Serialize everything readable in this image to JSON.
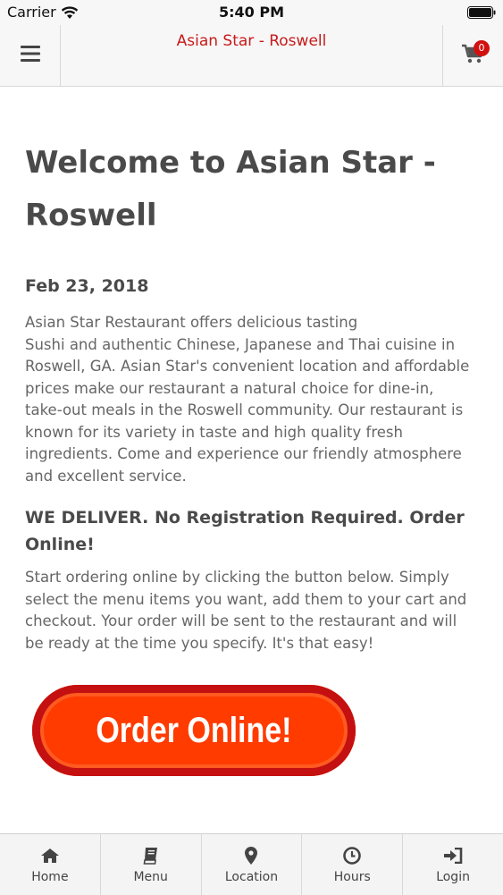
{
  "status_bar": {
    "carrier": "Carrier",
    "time": "5:40 PM"
  },
  "header": {
    "title": "Asian Star - Roswell",
    "cart_count": "0"
  },
  "main": {
    "title": "Welcome to Asian Star - Roswell",
    "date": "Feb 23, 2018",
    "intro_lines": [
      "Asian Star Restaurant offers delicious tasting",
      "Sushi and authentic Chinese, Japanese and Thai cuisine in Roswell, GA. Asian Star's convenient location and affordable prices make our restaurant a natural choice for dine-in, take-out meals in the Roswell community. Our restaurant is known for its variety in taste and high quality fresh ingredients. Come and experience our friendly atmosphere and excellent service."
    ],
    "delivery_heading": "WE DELIVER. No Registration Required. Order Online!",
    "instructions": "Start ordering online by clicking the button below. Simply select the menu items you want, add them to your cart and checkout. Your order will be sent to the restaurant and will be ready at the time you specify. It's that easy!",
    "order_button_label": "Order Online!"
  },
  "tabs": [
    {
      "label": "Home",
      "icon": "home-icon"
    },
    {
      "label": "Menu",
      "icon": "book-icon"
    },
    {
      "label": "Location",
      "icon": "map-marker-icon"
    },
    {
      "label": "Hours",
      "icon": "clock-icon"
    },
    {
      "label": "Login",
      "icon": "sign-in-icon"
    }
  ],
  "colors": {
    "brand_red": "#c81a1a",
    "order_button": "#ff3b00",
    "badge": "#d21010"
  }
}
